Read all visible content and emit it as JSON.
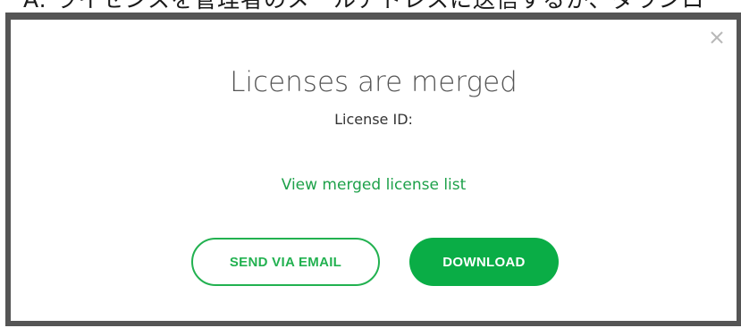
{
  "background_text": "A. ライセンスを管理者のメールアドレスに送信するか、ダウンロ",
  "dialog": {
    "title": "Licenses are merged",
    "license_id_label": "License ID:",
    "view_link": "View merged license list",
    "send_email_label": "SEND VIA EMAIL",
    "download_label": "DOWNLOAD",
    "close_icon": "close-icon"
  },
  "colors": {
    "accent": "#22b150",
    "download_bg": "#0aad46",
    "title": "#555555",
    "frame": "#555555"
  }
}
